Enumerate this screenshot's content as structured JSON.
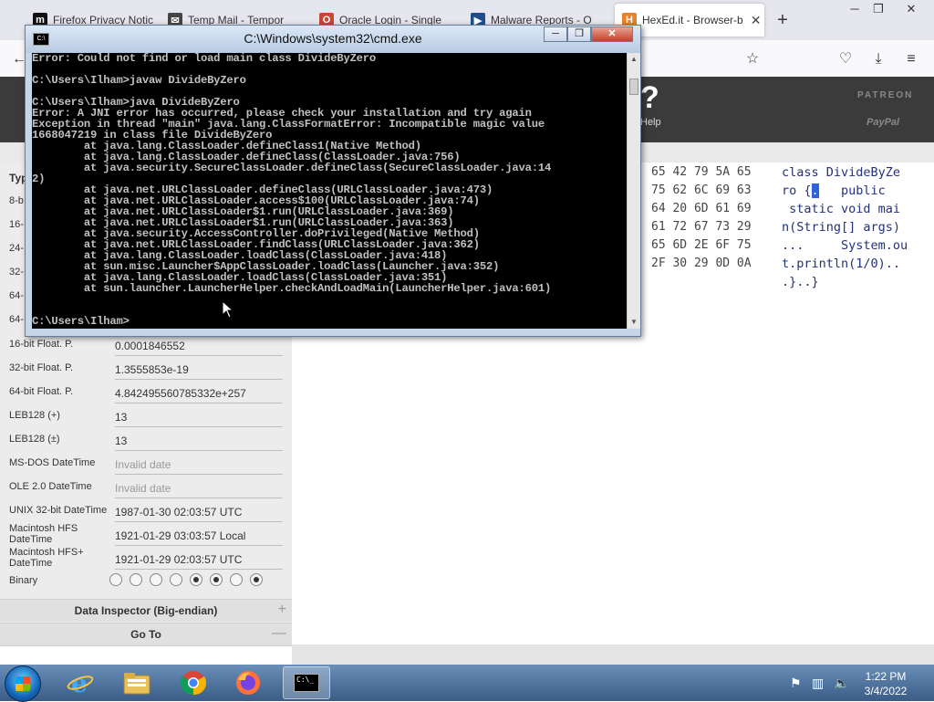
{
  "browser": {
    "tabs": [
      {
        "label": "Firefox Privacy Notic",
        "fav": "m",
        "fav_color": "#111111"
      },
      {
        "label": "Temp Mail - Tempor",
        "fav": "✉",
        "fav_color": "#444444"
      },
      {
        "label": "Oracle Login - Single",
        "fav": "O",
        "fav_color": "#c74634"
      },
      {
        "label": "Malware Reports - O",
        "fav": "▶",
        "fav_color": "#1f4e8c"
      },
      {
        "label": "HexEd.it - Browser-b",
        "fav": "H",
        "fav_color": "#e8812a"
      }
    ],
    "window_controls": [
      "─",
      "❐",
      "✕"
    ],
    "newtab_icon": "+",
    "nav_icons": [
      "back-icon",
      "star-icon",
      "pocket-icon",
      "download-icon",
      "menu-icon"
    ]
  },
  "hexed": {
    "help_symbol": "?",
    "help_label": "Help",
    "patreon_label": "PATREON",
    "paypal_label": "PayPal",
    "type_header": "Typ",
    "partial_labels": [
      "8-b",
      "16-",
      "24-",
      "32-",
      "64-",
      "64-"
    ],
    "inspector": [
      {
        "label": "16-bit Float. P.",
        "value": "0.0001846552",
        "invalid": false
      },
      {
        "label": "32-bit Float. P.",
        "value": "1.3555853e-19",
        "invalid": false
      },
      {
        "label": "64-bit Float. P.",
        "value": "4.842495560785332e+257",
        "invalid": false
      },
      {
        "label": "LEB128 (+)",
        "value": "13",
        "invalid": false
      },
      {
        "label": "LEB128 (±)",
        "value": "13",
        "invalid": false
      },
      {
        "label": "MS-DOS DateTime",
        "value": "Invalid date",
        "invalid": true
      },
      {
        "label": "OLE 2.0 DateTime",
        "value": "Invalid date",
        "invalid": true
      },
      {
        "label": "UNIX 32-bit DateTime",
        "value": "1987-01-30 02:03:57 UTC",
        "invalid": false
      },
      {
        "label": "Macintosh HFS DateTime",
        "value": "1921-01-29 03:03:57 Local",
        "invalid": false
      },
      {
        "label": "Macintosh HFS+ DateTime",
        "value": "1921-01-29 02:03:57 UTC",
        "invalid": false
      }
    ],
    "binary_label": "Binary",
    "binary_bits": [
      0,
      0,
      0,
      0,
      1,
      1,
      0,
      1
    ],
    "section_big_endian": "Data Inspector (Big-endian)",
    "section_big_endian_sign": "+",
    "section_goto": "Go To",
    "section_goto_sign": "—",
    "hex_lines": [
      "65 42 79 5A 65",
      "75 62 6C 69 63",
      "64 20 6D 61 69",
      "61 72 67 73 29",
      "65 6D 2E 6F 75",
      "2F 30 29 0D 0A"
    ],
    "ascii_lines": [
      "class DivideByZe",
      "ro {",
      ".",
      "   public",
      " static void mai",
      "n(String[] args)",
      "...     System.ou",
      "t.println(1/0)..",
      ".}..}"
    ]
  },
  "cmd": {
    "title": "C:\\Windows\\system32\\cmd.exe",
    "icon_text": "C:\\",
    "buttons": [
      "─",
      "❐",
      "✕"
    ],
    "lines": [
      "Error: Could not find or load main class DivideByZero",
      "",
      "C:\\Users\\Ilham>javaw DivideByZero",
      "",
      "C:\\Users\\Ilham>java DivideByZero",
      "Error: A JNI error has occurred, please check your installation and try again",
      "Exception in thread \"main\" java.lang.ClassFormatError: Incompatible magic value",
      "1668047219 in class file DivideByZero",
      "        at java.lang.ClassLoader.defineClass1(Native Method)",
      "        at java.lang.ClassLoader.defineClass(ClassLoader.java:756)",
      "        at java.security.SecureClassLoader.defineClass(SecureClassLoader.java:14",
      "2)",
      "        at java.net.URLClassLoader.defineClass(URLClassLoader.java:473)",
      "        at java.net.URLClassLoader.access$100(URLClassLoader.java:74)",
      "        at java.net.URLClassLoader$1.run(URLClassLoader.java:369)",
      "        at java.net.URLClassLoader$1.run(URLClassLoader.java:363)",
      "        at java.security.AccessController.doPrivileged(Native Method)",
      "        at java.net.URLClassLoader.findClass(URLClassLoader.java:362)",
      "        at java.lang.ClassLoader.loadClass(ClassLoader.java:418)",
      "        at sun.misc.Launcher$AppClassLoader.loadClass(Launcher.java:352)",
      "        at java.lang.ClassLoader.loadClass(ClassLoader.java:351)",
      "        at sun.launcher.LauncherHelper.checkAndLoadMain(LauncherHelper.java:601)",
      "",
      "",
      "C:\\Users\\Ilham>"
    ]
  },
  "taskbar": {
    "icons": [
      "ie-icon",
      "explorer-icon",
      "chrome-icon",
      "firefox-icon",
      "cmd-icon"
    ],
    "cmd_icon_text": "C:\\_",
    "time": "1:22 PM",
    "date": "3/4/2022",
    "tray_icons": [
      "flag-icon",
      "network-icon",
      "volume-icon"
    ]
  },
  "colors": {
    "firefox_tab_bg": "#e6e6ee",
    "hexed_header": "#3b3b3b",
    "console_text": "#c0c0c0",
    "ascii_text": "#22317a",
    "selection": "#2b63d9"
  }
}
